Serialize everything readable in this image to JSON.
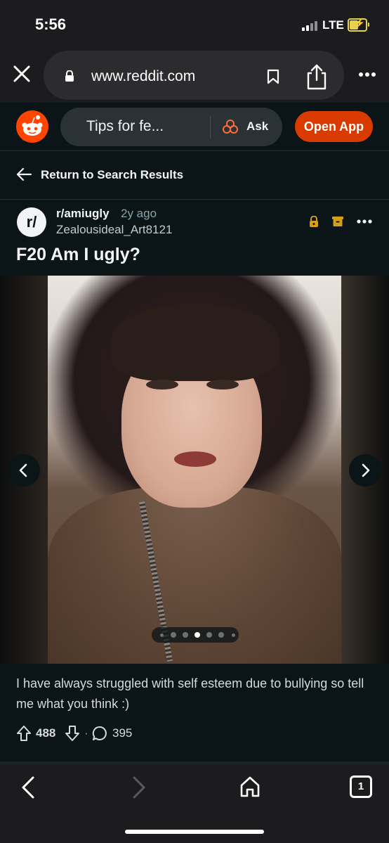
{
  "status_bar": {
    "time": "5:56",
    "network": "LTE",
    "battery_icon": "battery-charging-icon"
  },
  "browser": {
    "url": "www.reddit.com",
    "icons": [
      "close-icon",
      "lock-icon",
      "bookmark-icon",
      "share-icon",
      "more-icon"
    ]
  },
  "reddit_header": {
    "search_text": "Tips for fe...",
    "ask_label": "Ask",
    "open_app_label": "Open App"
  },
  "nav": {
    "return_label": "Return to Search Results"
  },
  "post": {
    "subreddit_avatar": "r/",
    "subreddit": "r/amiugly",
    "age": "2y ago",
    "author": "Zealousideal_Art8121",
    "title": "F20 Am I ugly?",
    "body": "I have always struggled with self esteem due to bullying so tell me what you think :)",
    "score": "488",
    "separator": "·",
    "comments": "395",
    "carousel": {
      "total": 7,
      "active_index": 3
    }
  },
  "bottom_bar": {
    "tabs_count": "1"
  },
  "colors": {
    "background": "#0b1416",
    "accent": "#d93a00",
    "lock": "#d4a017"
  }
}
